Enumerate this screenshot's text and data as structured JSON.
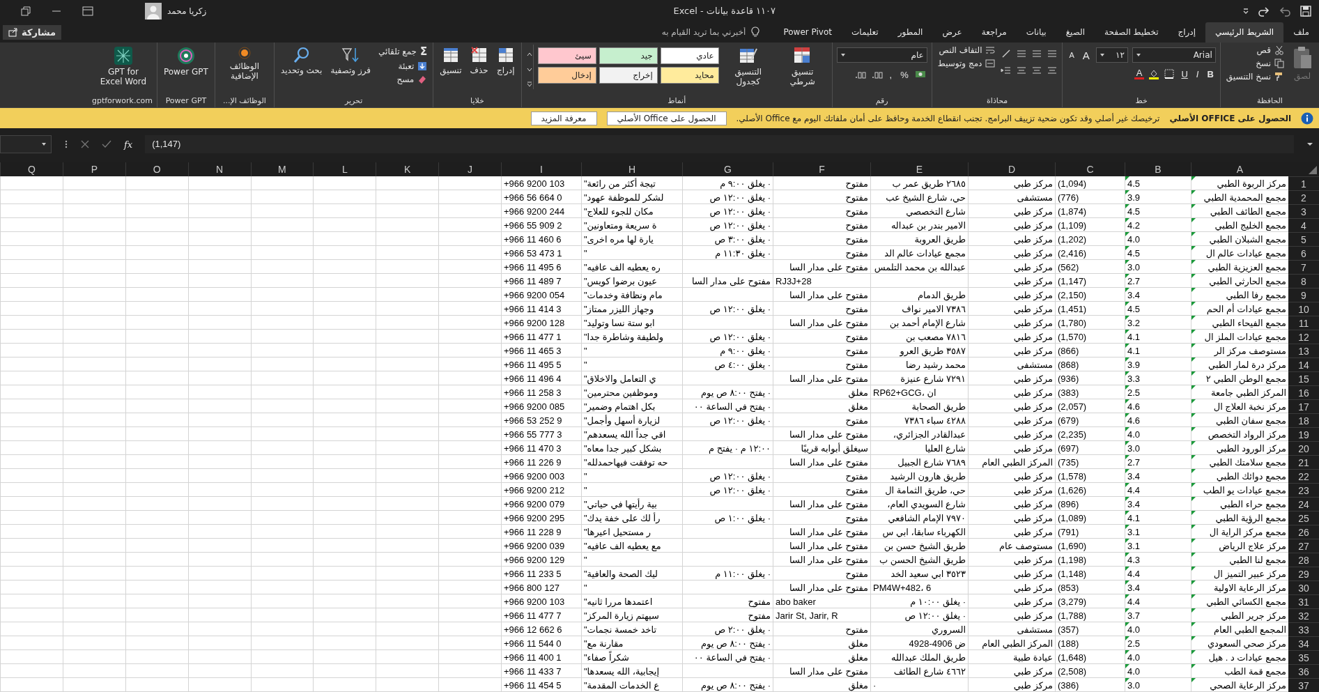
{
  "title_bar": {
    "title": "١١٠٧ قاعدة بيانات  -  Excel",
    "user": "زكريا محمد"
  },
  "tabs": [
    {
      "label": "ملف",
      "selected": false
    },
    {
      "label": "الشريط الرئيسي",
      "selected": true
    },
    {
      "label": "إدراج",
      "selected": false
    },
    {
      "label": "تخطيط الصفحة",
      "selected": false
    },
    {
      "label": "الصيغ",
      "selected": false
    },
    {
      "label": "بيانات",
      "selected": false
    },
    {
      "label": "مراجعة",
      "selected": false
    },
    {
      "label": "عرض",
      "selected": false
    },
    {
      "label": "المطور",
      "selected": false
    },
    {
      "label": "تعليمات",
      "selected": false
    },
    {
      "label": "Power Pivot",
      "selected": false
    }
  ],
  "tell_me": {
    "placeholder": "أخبرني بما تريد القيام به"
  },
  "share": "مشاركة",
  "ribbon": {
    "clipboard": {
      "paste": "لصق",
      "paste_disabled": true,
      "cut": "قص",
      "copy": "نسخ",
      "format_painter": "نسخ التنسيق",
      "label": "الحافظة"
    },
    "font": {
      "name": "Arial",
      "size": "١٢",
      "grow": "A",
      "shrink": "A",
      "bold": "B",
      "italic": "I",
      "underline": "U",
      "font_color": "A",
      "label": "خط"
    },
    "alignment": {
      "wrap": "التفاف النص",
      "merge": "دمج وتوسيط",
      "label": "محاذاة"
    },
    "number": {
      "format": "عام",
      "percent": "%",
      "comma": ",",
      "label": "رقم"
    },
    "styles": {
      "conditional": "تنسيق شرطي",
      "as_table": "التنسيق كجدول",
      "label": "أنماط",
      "cell_styles": [
        {
          "label": "عادي",
          "color": "#ffffff"
        },
        {
          "label": "جيد",
          "color": "#c6efce"
        },
        {
          "label": "سيئ",
          "color": "#ffc7ce"
        },
        {
          "label": "محايد",
          "color": "#ffeb9c"
        },
        {
          "label": "إخراج",
          "color": "#f2f2f2"
        },
        {
          "label": "إدخال",
          "color": "#ffcc99"
        }
      ]
    },
    "cells": {
      "insert": "إدراج",
      "delete": "حذف",
      "format": "تنسيق",
      "label": "خلايا"
    },
    "editing": {
      "sigma": "Σ",
      "autosum": "جمع تلقائي",
      "fill": "تعبئة",
      "clear": "مسح",
      "sort": "فرز وتصفية",
      "find": "بحث وتحديد",
      "label": "تحرير"
    },
    "addins": {
      "button": "الوظائف الإضافية",
      "label": "الوظائف الإ..."
    },
    "power_gpt": {
      "button": "Power GPT",
      "label": "Power GPT"
    },
    "gpt_for_work": {
      "button": "GPT for Excel Word",
      "label": "gptforwork.com"
    }
  },
  "info_bar": {
    "title": "الحصول على OFFICE الأصلي",
    "message": "ترخيصك غير أصلي وقد تكون ضحية تزييف البرامج. تجنب انقطاع الخدمة وحافظ على أمان ملفاتك اليوم مع Office الأصلي.",
    "buttons": [
      "الحصول على Office الأصلي",
      "معرفة المزيد"
    ]
  },
  "formula_bar": {
    "fx": "fx",
    "value": "(1,147)"
  },
  "columns": [
    "A",
    "B",
    "C",
    "D",
    "E",
    "F",
    "G",
    "H",
    "I",
    "J",
    "K",
    "L",
    "M",
    "N",
    "O",
    "P",
    "Q"
  ],
  "rows": [
    {
      "number": "1",
      "flags": true,
      "cells": [
        "مركز الربوة الطبي",
        "4.5",
        "(1,094)",
        "مركز طبي",
        "٢٦٨٥ طريق عمر ب",
        "مفتوح",
        "· يغلق ٩:٠٠ م",
        "تيجة أكثر من رائعة\"",
        "+966 9200 103"
      ]
    },
    {
      "number": "2",
      "flags": true,
      "cells": [
        "مجمع المحمدية الطبي",
        "3.9",
        "(776)",
        "مستشفى",
        "حي، شارع الشيخ عب",
        "مفتوح",
        "· يغلق ١٢:٠٠ ص",
        "لشكر للموظفة عهود\"",
        "+966 56 664 0"
      ]
    },
    {
      "number": "3",
      "flags": true,
      "cells": [
        "مجمع الطائف الطبي",
        "4.5",
        "(1,874)",
        "مركز طبي",
        "شارع التخصصي",
        "مفتوح",
        "· يغلق ١٢:٠٠ ص",
        "مكان للجوء للعلاج\"",
        "+966 9200 244"
      ]
    },
    {
      "number": "4",
      "flags": true,
      "cells": [
        "مجمع الخليج الطبي",
        "4.2",
        "(1,109)",
        "مركز طبي",
        "الامير بندر بن عبداله",
        "مفتوح",
        "· يغلق ١٢:٠٠ ص",
        "ة سريعة ومتعاونين\"",
        "+966 55 909 2"
      ]
    },
    {
      "number": "5",
      "flags": true,
      "cells": [
        "مجمع الشبلان الطبي",
        "4.0",
        "(1,202)",
        "مركز طبي",
        "طريق العروبة",
        "مفتوح",
        "· يغلق ٣:٠٠ ص",
        "يارة لها مره اخرى\"",
        "+966 11 460 6"
      ]
    },
    {
      "number": "6",
      "flags": true,
      "cells": [
        "مجمع عيادات عالم ال",
        "4.5",
        "(2,416)",
        "مركز طبي",
        "مجمع عيادات عالم الد",
        "مفتوح",
        "· يغلق ١١:٣٠ م",
        "\"",
        "+966 53 473 1"
      ]
    },
    {
      "number": "7",
      "flags": true,
      "cells": [
        "مجمع العزيزية الطبي",
        "3.0",
        "(562)",
        "مركز طبي",
        "عبدالله بن محمد التلمس",
        "مفتوح على مدار السا",
        "",
        "ره يعطيه الف عافيه\"",
        "+966 11 495 6"
      ]
    },
    {
      "number": "8",
      "flags": true,
      "cells": [
        "مجمع الحارثي الطبي",
        "2.7",
        "(1,147)",
        "مركز طبي",
        "",
        "RJ3J+28",
        "مفتوح على مدار السا",
        "عيون برضوا كويس\"",
        "+966 11 489 7"
      ]
    },
    {
      "number": "9",
      "flags": true,
      "cells": [
        "مجمع رفا الطبي",
        "3.4",
        "(2,150)",
        "مركز طبي",
        "طريق الدمام",
        "مفتوح على مدار السا",
        "",
        "مام ونظافة وخدمات\"",
        "+966 9200 054"
      ]
    },
    {
      "number": "10",
      "flags": true,
      "cells": [
        "مجمع عيادات أم الحم",
        "4.5",
        "(1,451)",
        "مركز طبي",
        "٧٣٨٦ الامير نواف",
        "مفتوح",
        "· يغلق ١٢:٠٠ ص",
        "وجهاز الليزر ممتاز\"",
        "+966 11 414 3"
      ]
    },
    {
      "number": "11",
      "flags": true,
      "cells": [
        "مجمع الفيحاء الطبي",
        "3.2",
        "(1,780)",
        "مركز طبي",
        "شارع الإمام أحمد بن",
        "مفتوح على مدار السا",
        "",
        "ابو ستة نسا وتوليد\"",
        "+966 9200 128"
      ]
    },
    {
      "number": "12",
      "flags": true,
      "cells": [
        "مجمع عيادات الملز ال",
        "4.1",
        "(1,570)",
        "مركز طبي",
        "٧٨١٦ مصعب بن",
        "مفتوح",
        "· يغلق ١٢:٠٠ ص",
        "ولطيفة وشاطرة جدا\"",
        "+966 11 477 1"
      ]
    },
    {
      "number": "13",
      "flags": true,
      "cells": [
        "مستوصف مركز الر",
        "4.1",
        "(866)",
        "مركز طبي",
        "٣٥٨٧ طريق العرو",
        "مفتوح",
        "· يغلق ٩:٠٠ م",
        "\"",
        "+966 11 465 3"
      ]
    },
    {
      "number": "14",
      "flags": true,
      "cells": [
        "مركز درة لمار الطبي",
        "3.9",
        "(868)",
        "مستشفى",
        "محمد رشيد رضا",
        "مفتوح",
        "· يغلق ٤:٠٠ ص",
        "\"",
        "+966 11 495 5"
      ]
    },
    {
      "number": "15",
      "flags": true,
      "cells": [
        "مجمع الوطن الطبي ٢",
        "3.3",
        "(936)",
        "مركز طبي",
        "٧٢٩١ شارع عنيزة",
        "مفتوح على مدار السا",
        "",
        "ي التعامل والاخلاق\"",
        "+966 11 496 4"
      ]
    },
    {
      "number": "16",
      "flags": true,
      "cells": [
        "المركز الطبي جامعة",
        "2.5",
        "(383)",
        "مركز طبي",
        "RP62+GCG، ان",
        "مغلق",
        "· يفتح ٨:٠٠ ص يوم",
        "وموظفين محترمين\"",
        "+966 11 258 3"
      ]
    },
    {
      "number": "17",
      "flags": true,
      "cells": [
        "مركز نخبة العلاج ال",
        "4.6",
        "(2,057)",
        "مركز طبي",
        "طريق الصحابة",
        "مغلق",
        "· يفتح في الساعة ٠٠",
        "بكل اهتمام وضمير\"",
        "+966 9200 085"
      ]
    },
    {
      "number": "18",
      "flags": true,
      "cells": [
        "مجمع سفان الطبي",
        "4.6",
        "(679)",
        "مركز طبي",
        "٤٢٨٨ سباء ٧٣٨٦",
        "مفتوح",
        "· يغلق ١٢:٠٠ ص",
        "لزيارة أسهل وأجمل\"",
        "+966 53 252 9"
      ]
    },
    {
      "number": "19",
      "flags": true,
      "cells": [
        "مركز الرواد التخصص",
        "4.0",
        "(2,235)",
        "مركز طبي",
        "عبدالقادر الجزائري،",
        "مفتوح على مدار السا",
        "",
        "اقي جداً الله يسعدهم\"",
        "+966 55 777 3"
      ]
    },
    {
      "number": "20",
      "flags": true,
      "cells": [
        "مركز الورود الطبي",
        "3.0",
        "(697)",
        "مركز طبي",
        "شارع العليا",
        "سيغلق أبوابه قريبًا",
        "١٢:٠٠ م · يفتح م",
        "بشكل كبير جدا معاه\"",
        "+966 11 470 3"
      ]
    },
    {
      "number": "21",
      "flags": true,
      "cells": [
        "مجمع سلامتك الطبي",
        "2.7",
        "(735)",
        "المركز الطبي العام",
        "٧٦٨٩ شارع الجبيل",
        "مفتوح على مدار السا",
        "",
        "حه توفقت فيهاحمدلله\"",
        "+966 11 226 9"
      ]
    },
    {
      "number": "22",
      "flags": true,
      "cells": [
        "مجمع دوائك الطبي",
        "3.4",
        "(1,578)",
        "مركز طبي",
        "طريق هارون الرشيد",
        "مفتوح",
        "· يغلق ١٢:٠٠ ص",
        "\"",
        "+966 9200 003"
      ]
    },
    {
      "number": "23",
      "flags": true,
      "cells": [
        "مجمع عيادات يو الطب",
        "4.4",
        "(1,626)",
        "مركز طبي",
        "حي، طريق الثمامة ال",
        "مفتوح",
        "· يغلق ١٢:٠٠ ص",
        "\"",
        "+966 9200 212"
      ]
    },
    {
      "number": "24",
      "flags": true,
      "cells": [
        "مجمع حراء الطبي",
        "3.4",
        "(896)",
        "مركز طبي",
        "شارع السويدي العام،",
        "مفتوح على مدار السا",
        "",
        "بية رأيتها في حياتي\"",
        "+966 9200 079"
      ]
    },
    {
      "number": "25",
      "flags": true,
      "cells": [
        "مجمع الرؤية الطبي",
        "4.1",
        "(1,089)",
        "مركز طبي",
        "٧٩٧٠ الإمام الشافعي",
        "مفتوح",
        "· يغلق ١:٠٠ ص",
        "رأ لك على خفة يدك\"",
        "+966 9200 295"
      ]
    },
    {
      "number": "26",
      "flags": true,
      "cells": [
        "مجمع مركز الراية ال",
        "3.1",
        "(791)",
        "مركز طبي",
        "الكهرباء سابقا، ابي س",
        "مفتوح على مدار السا",
        "",
        "ر مستحيل اعيرها\"",
        "+966 11 228 9"
      ]
    },
    {
      "number": "27",
      "flags": true,
      "cells": [
        "مركز علاج الرياض",
        "3.1",
        "(1,690)",
        "مستوصف عام",
        "طريق الشيخ حسن بن",
        "مفتوح على مدار السا",
        "",
        "مع يعطيه الف عافيه\"",
        "+966 9200 039"
      ]
    },
    {
      "number": "28",
      "flags": true,
      "cells": [
        "مجمع لنا الطبي",
        "4.3",
        "(1,198)",
        "مركز طبي",
        "طريق الشيخ الحسن ب",
        "مفتوح على مدار السا",
        "",
        "\"",
        "+966 9200 129"
      ]
    },
    {
      "number": "29",
      "flags": true,
      "cells": [
        "مركز عبير التميز ال",
        "4.4",
        "(1,148)",
        "مركز طبي",
        "٣٥٢٣ ابي سعيد الخد",
        "مفتوح",
        "· يغلق ١١:٠٠ م",
        "ليك الصحة والعافية\"",
        "+966 11 233 5"
      ]
    },
    {
      "number": "30",
      "flags": true,
      "cells": [
        "مركز الرعاية الاولية",
        "3.4",
        "(853)",
        "مركز طبي",
        "PM4W+482، 6",
        "مفتوح على مدار السا",
        "",
        "\"",
        "+966 800 127"
      ]
    },
    {
      "number": "31",
      "flags": true,
      "cells": [
        "مجمع الكسائي الطبي",
        "4.4",
        "(3,279)",
        "مركز طبي",
        "· يغلق ١٠:٠٠ م",
        "abo baker",
        "مفتوح",
        "اعتمدها مررا ثانيه\"",
        "+966 9200 103"
      ]
    },
    {
      "number": "32",
      "flags": true,
      "cells": [
        "مركز جرير الطبي",
        "3.7",
        "(1,788)",
        "مركز طبي",
        "· يغلق ١٢:٠٠ ص",
        "Jarir St, Jarir, R",
        "مفتوح",
        "سيهتم زيارة المركز\"",
        "+966 11 477 7"
      ]
    },
    {
      "number": "33",
      "flags": true,
      "cells": [
        "المجمع الطبي العام",
        "4.0",
        "(357)",
        "مستشفى",
        "السروري",
        "مفتوح",
        "· يغلق ٢:٠٠ ص",
        "تاخد خمسة نجمات\"",
        "+966 12 662 6"
      ]
    },
    {
      "number": "34",
      "flags": true,
      "cells": [
        "مركز صحي السعودي",
        "2.5",
        "(188)",
        "المركز الطبي العام",
        "ض 4906-4928",
        "مغلق",
        "· يفتح ٨:٠٠ ص يوم",
        "مقارنة مع\"",
        "+966 11 544 0"
      ]
    },
    {
      "number": "35",
      "flags": true,
      "cells": [
        "مجمع عيادات د . هيل",
        "4.0",
        "(1,648)",
        "عيادة طبية",
        "طريق الملك عبدالله",
        "مغلق",
        "· يفتح في الساعة ٠٠",
        "شكراً صفاء\"",
        "+966 11 400 1"
      ]
    },
    {
      "number": "36",
      "flags": true,
      "cells": [
        "مجمع قمة الطب",
        "4.0",
        "(2,508)",
        "مركز طبي",
        "٤٦٦٢ شارع الطائف",
        "مفتوح على مدار السا",
        "",
        "إيجابية، الله يسعدها\"",
        "+966 11 433 7"
      ]
    },
    {
      "number": "37",
      "flags": true,
      "cells": [
        "مركز الرعاية الصحي",
        "3.0",
        "(386)",
        "مركز طبي",
        "·",
        "مغلق",
        "· يفتح ٨:٠٠ ص يوم",
        "ع الخدمات المقدمة\"",
        "+966 11 454 5"
      ]
    }
  ]
}
